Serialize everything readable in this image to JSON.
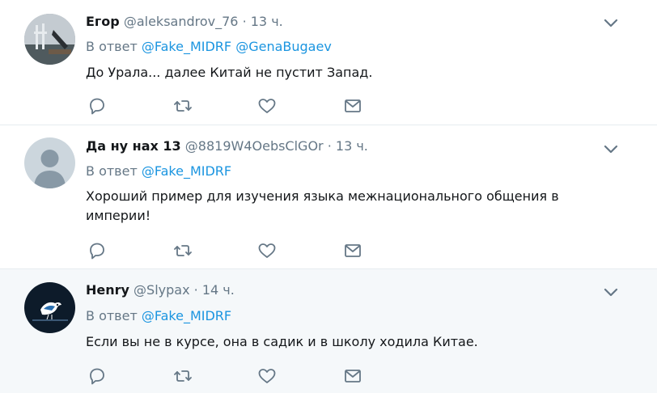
{
  "tweets": [
    {
      "name": "Егор",
      "handle": "@aleksandrov_76",
      "dot": "·",
      "time": "13 ч.",
      "reply_prefix": "В ответ",
      "mentions": [
        "@Fake_MIDRF",
        "@GenaBugaev"
      ],
      "text": "До Урала... далее Китай не пустит Запад.",
      "avatar": "photo"
    },
    {
      "name": "Да ну нах 13",
      "handle": "@8819W4OebsClGOr",
      "dot": "·",
      "time": "13 ч.",
      "reply_prefix": "В ответ",
      "mentions": [
        "@Fake_MIDRF"
      ],
      "text": "Хороший пример для изучения языка межнационального общения в империи!",
      "avatar": "default-silhouette"
    },
    {
      "name": "Henry",
      "handle": "@Slypax",
      "dot": "·",
      "time": "14 ч.",
      "reply_prefix": "В ответ",
      "mentions": [
        "@Fake_MIDRF"
      ],
      "text": "Если вы не в курсе, она в садик и в школу ходила  Китае.",
      "avatar": "bird"
    }
  ],
  "icons": {
    "reply": "reply-icon",
    "retweet": "retweet-icon",
    "like": "heart-icon",
    "dm": "envelope-icon",
    "more": "chevron-down-icon"
  },
  "colors": {
    "link": "#1b95e0",
    "muted": "#657786",
    "text": "#14171a",
    "highlight_bg": "#f5f8fa",
    "divider": "#e6ecf0"
  }
}
